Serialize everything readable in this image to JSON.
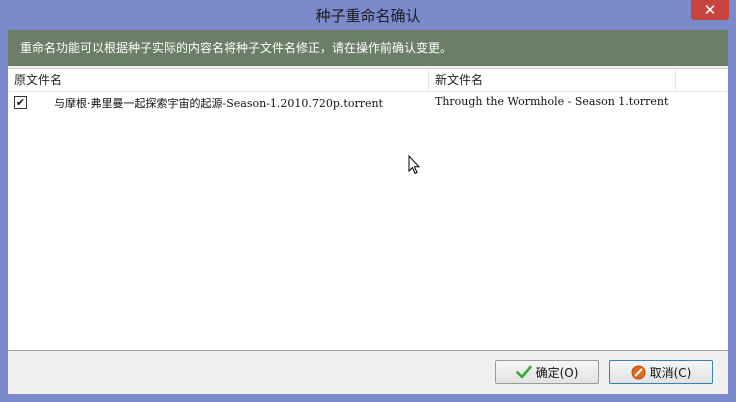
{
  "window": {
    "title": "种子重命名确认",
    "close_label": "✕"
  },
  "banner": {
    "text": "重命名功能可以根据种子实际的内容名将种子文件名修正，请在操作前确认变更。"
  },
  "table": {
    "columns": [
      "原文件名",
      "新文件名"
    ],
    "rows": [
      {
        "checked": true,
        "check_glyph": "✔",
        "old_name": "与摩根·弗里曼一起探索宇宙的起源-Season-1.2010.720p.torrent",
        "new_name": "Through the Wormhole - Season 1.torrent"
      }
    ]
  },
  "buttons": {
    "ok_label": "确定(O)",
    "cancel_label": "取消(C)"
  },
  "colors": {
    "frame": "#7b8acb",
    "banner": "#6b7e67",
    "close": "#c7453d"
  }
}
